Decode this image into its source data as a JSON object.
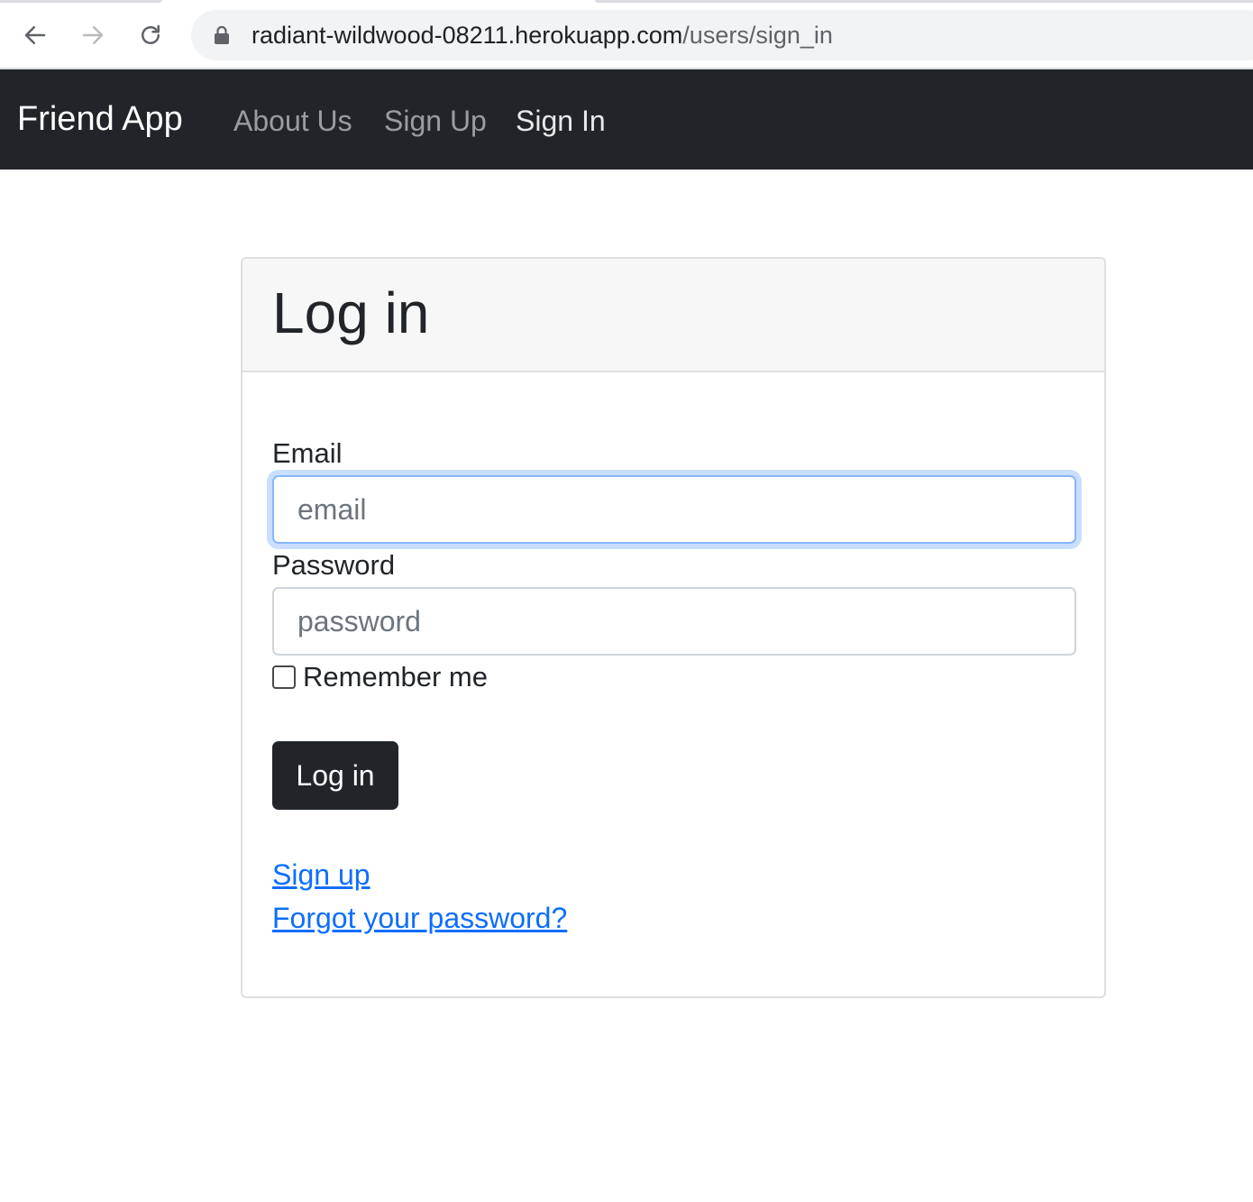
{
  "browser": {
    "url_host": "radiant-wildwood-08211.herokuapp.com",
    "url_path": "/users/sign_in",
    "icons": [
      "back-arrow-icon",
      "forward-arrow-icon",
      "reload-icon",
      "lock-icon"
    ]
  },
  "navbar": {
    "brand": "Friend App",
    "links": [
      {
        "label": "About Us",
        "active": false
      },
      {
        "label": "Sign Up",
        "active": false
      },
      {
        "label": "Sign In",
        "active": true
      }
    ],
    "background": "#212529"
  },
  "card": {
    "title": "Log in",
    "email": {
      "label": "Email",
      "placeholder": "email",
      "value": ""
    },
    "password": {
      "label": "Password",
      "placeholder": "password",
      "value": ""
    },
    "remember": {
      "label": "Remember me",
      "checked": false
    },
    "submit_label": "Log in",
    "links": {
      "signup": "Sign up",
      "forgot": "Forgot your password?"
    }
  },
  "colors": {
    "link": "#0d6efd",
    "focus_ring": "#86b7fe",
    "button": "#212529"
  }
}
